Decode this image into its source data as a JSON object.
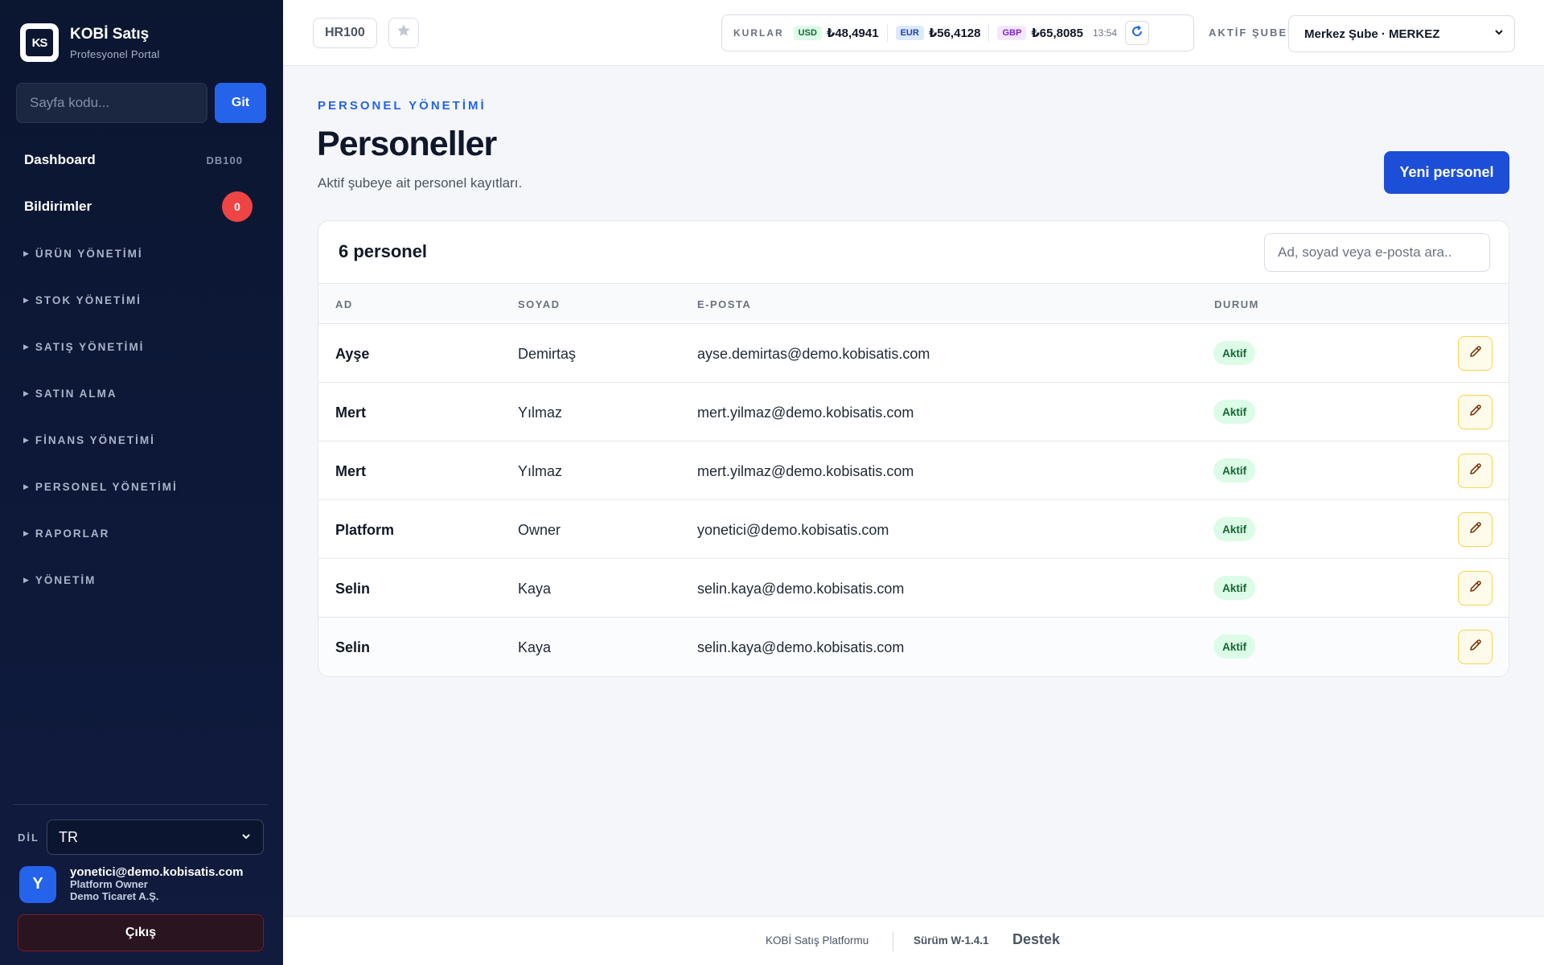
{
  "sidebar": {
    "brand_name": "KOBİ Satış",
    "brand_sub": "Profesyonel Portal",
    "logo_text": "KS",
    "page_code_placeholder": "Sayfa kodu...",
    "go_label": "Git",
    "dashboard": {
      "label": "Dashboard",
      "code": "DB100"
    },
    "notifications": {
      "label": "Bildirimler",
      "count": "0"
    },
    "groups": [
      "ÜRÜN YÖNETİMİ",
      "STOK YÖNETİMİ",
      "SATIŞ YÖNETİMİ",
      "SATIN ALMA",
      "FİNANS YÖNETİMİ",
      "PERSONEL YÖNETİMİ",
      "RAPORLAR",
      "YÖNETİM"
    ],
    "lang_label": "DİL",
    "lang_value": "TR",
    "user": {
      "initial": "Y",
      "email": "yonetici@demo.kobisatis.com",
      "role": "Platform Owner",
      "company": "Demo Ticaret A.Ş."
    },
    "logout_label": "Çıkış"
  },
  "topbar": {
    "page_code": "HR100",
    "rates_label": "KURLAR",
    "rates": [
      {
        "code": "USD",
        "value": "₺48,4941"
      },
      {
        "code": "EUR",
        "value": "₺56,4128"
      },
      {
        "code": "GBP",
        "value": "₺65,8085"
      }
    ],
    "rates_time": "13:54",
    "branch_label": "AKTİF ŞUBE",
    "branch_value": "Merkez Şube · MERKEZ"
  },
  "main": {
    "eyebrow": "PERSONEL YÖNETİMİ",
    "title": "Personeller",
    "subtitle": "Aktif şubeye ait personel kayıtları.",
    "new_label": "Yeni personel",
    "count_label": "6 personel",
    "search_placeholder": "Ad, soyad veya e-posta ara..",
    "columns": {
      "ad": "AD",
      "soyad": "SOYAD",
      "eposta": "E-POSTA",
      "durum": "DURUM"
    },
    "rows": [
      {
        "ad": "Ayşe",
        "soyad": "Demirtaş",
        "eposta": "ayse.demirtas@demo.kobisatis.com",
        "durum": "Aktif"
      },
      {
        "ad": "Mert",
        "soyad": "Yılmaz",
        "eposta": "mert.yilmaz@demo.kobisatis.com",
        "durum": "Aktif"
      },
      {
        "ad": "Mert",
        "soyad": "Yılmaz",
        "eposta": "mert.yilmaz@demo.kobisatis.com",
        "durum": "Aktif"
      },
      {
        "ad": "Platform",
        "soyad": "Owner",
        "eposta": "yonetici@demo.kobisatis.com",
        "durum": "Aktif"
      },
      {
        "ad": "Selin",
        "soyad": "Kaya",
        "eposta": "selin.kaya@demo.kobisatis.com",
        "durum": "Aktif"
      },
      {
        "ad": "Selin",
        "soyad": "Kaya",
        "eposta": "selin.kaya@demo.kobisatis.com",
        "durum": "Aktif"
      }
    ]
  },
  "footer": {
    "platform": "KOBİ Satış Platformu",
    "version": "Sürüm W-1.4.1",
    "support": "Destek"
  },
  "colors": {
    "accent": "#2563eb",
    "sidebar_bg": "#0b1631",
    "status_bg": "#dcfce7",
    "status_fg": "#166534",
    "edit_border": "#fcd34d"
  },
  "icons": {
    "favorite": "star-icon",
    "refresh": "refresh-icon",
    "edit": "pencil-icon",
    "dropdown": "chevron-down-icon",
    "group": "caret-right-icon"
  }
}
